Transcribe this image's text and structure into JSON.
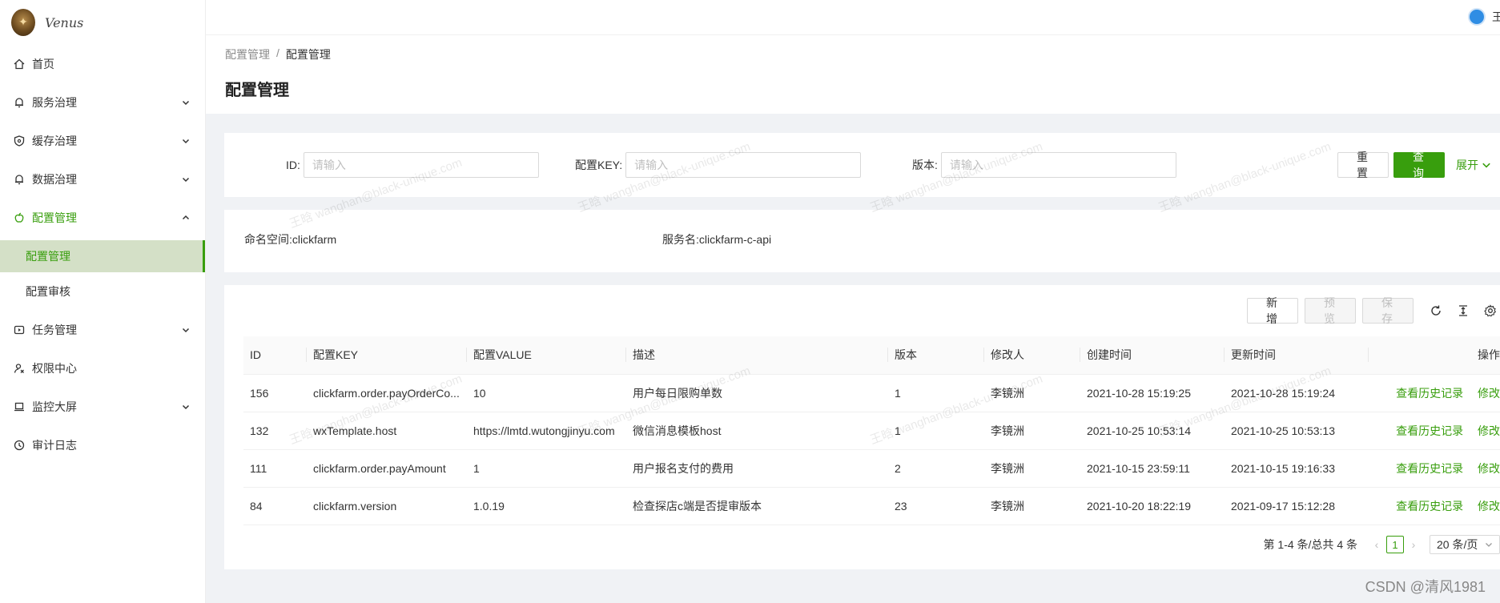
{
  "app": {
    "logo_text": "Venus"
  },
  "header": {
    "user_name": "王"
  },
  "sidebar": {
    "items": [
      {
        "label": "首页",
        "icon": "home-icon",
        "has_children": false
      },
      {
        "label": "服务治理",
        "icon": "bell-icon",
        "has_children": true
      },
      {
        "label": "缓存治理",
        "icon": "shield-icon",
        "has_children": true
      },
      {
        "label": "数据治理",
        "icon": "bell-icon",
        "has_children": true
      },
      {
        "label": "配置管理",
        "icon": "apple-icon",
        "has_children": true,
        "expanded": true,
        "children": [
          {
            "label": "配置管理",
            "selected": true
          },
          {
            "label": "配置审核",
            "selected": false
          }
        ]
      },
      {
        "label": "任务管理",
        "icon": "play-square-icon",
        "has_children": true
      },
      {
        "label": "权限中心",
        "icon": "user-switch-icon",
        "has_children": false
      },
      {
        "label": "监控大屏",
        "icon": "laptop-icon",
        "has_children": true
      },
      {
        "label": "审计日志",
        "icon": "history-icon",
        "has_children": false
      }
    ]
  },
  "breadcrumb": {
    "parent": "配置管理",
    "separator": "/",
    "current": "配置管理"
  },
  "page": {
    "title": "配置管理"
  },
  "search": {
    "id_label": "ID:",
    "id_placeholder": "请输入",
    "key_label": "配置KEY:",
    "key_placeholder": "请输入",
    "version_label": "版本:",
    "version_placeholder": "请输入",
    "reset_label": "重 置",
    "query_label": "查 询",
    "expand_label": "展开"
  },
  "info": {
    "namespace_label": "命名空间:",
    "namespace_value": "clickfarm",
    "service_label": "服务名:",
    "service_value": "clickfarm-c-api"
  },
  "toolbar": {
    "add_label": "新 增",
    "preview_label": "预 览",
    "save_label": "保 存"
  },
  "table": {
    "columns": [
      "ID",
      "配置KEY",
      "配置VALUE",
      "描述",
      "版本",
      "修改人",
      "创建时间",
      "更新时间",
      "操作"
    ],
    "rows": [
      {
        "id": "156",
        "key": "clickfarm.order.payOrderCo...",
        "value": "10",
        "desc": "用户每日限购单数",
        "version": "1",
        "modifier": "李镜洲",
        "created": "2021-10-28 15:19:25",
        "updated": "2021-10-28 15:19:24",
        "history": "查看历史记录",
        "edit": "修改"
      },
      {
        "id": "132",
        "key": "wxTemplate.host",
        "value": "https://lmtd.wutongjinyu.com",
        "desc": "微信消息模板host",
        "version": "1",
        "modifier": "李镜洲",
        "created": "2021-10-25 10:53:14",
        "updated": "2021-10-25 10:53:13",
        "history": "查看历史记录",
        "edit": "修改"
      },
      {
        "id": "111",
        "key": "clickfarm.order.payAmount",
        "value": "1",
        "desc": "用户报名支付的费用",
        "version": "2",
        "modifier": "李镜洲",
        "created": "2021-10-15 23:59:11",
        "updated": "2021-10-15 19:16:33",
        "history": "查看历史记录",
        "edit": "修改"
      },
      {
        "id": "84",
        "key": "clickfarm.version",
        "value": "1.0.19",
        "desc": "检查探店c端是否提审版本",
        "version": "23",
        "modifier": "李镜洲",
        "created": "2021-10-20 18:22:19",
        "updated": "2021-09-17 15:12:28",
        "history": "查看历史记录",
        "edit": "修改"
      }
    ]
  },
  "pagination": {
    "summary": "第 1-4 条/总共 4 条",
    "current_page": "1",
    "page_size": "20 条/页"
  },
  "watermark": "王晗 wanghan@black-unique.com",
  "footer_mark": "CSDN @清风1981",
  "colors": {
    "primary": "#389e0d",
    "selected_bg": "#d4e0c7",
    "page_bg": "#f0f2f5"
  }
}
